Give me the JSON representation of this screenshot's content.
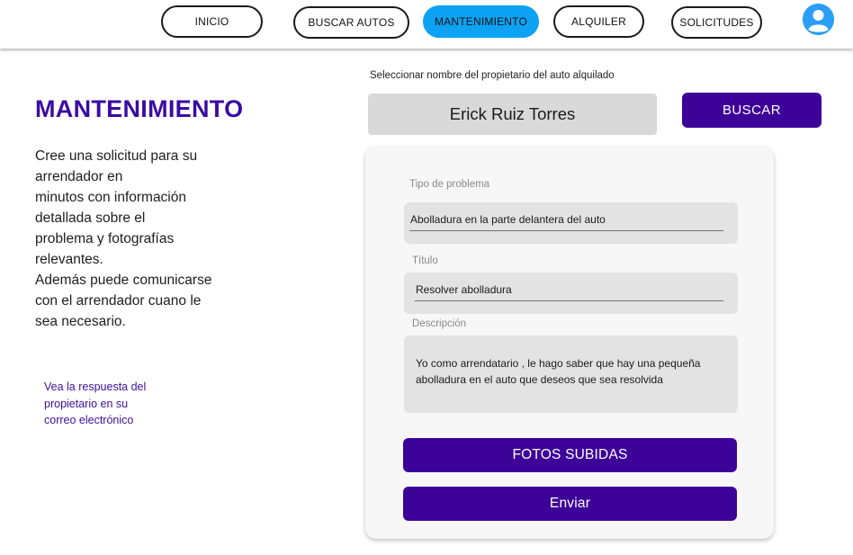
{
  "nav": {
    "items": [
      {
        "label": "INICIO",
        "active": false
      },
      {
        "label": "BUSCAR AUTOS",
        "active": false
      },
      {
        "label": "MANTENIMIENTO",
        "active": true
      },
      {
        "label": "ALQUILER",
        "active": false
      },
      {
        "label": "SOLICITUDES",
        "active": false
      }
    ],
    "avatar_icon": "user-avatar-icon"
  },
  "left": {
    "title": "MANTENIMIENTO",
    "intro": "Cree una solicitud para su\n arrendador en\nminutos con información\ndetallada sobre el\nproblema y fotografías\nrelevantes.\nAdemás puede comunicarse\ncon el arrendador cuano le\nsea necesario.",
    "note": "Vea la respuesta del\npropietario en su\ncorreo electrónico"
  },
  "search": {
    "label": "Seleccionar  nombre del propietario del auto  alquilado",
    "owner_value": "Erick Ruiz Torres",
    "button_label": "BUSCAR"
  },
  "form": {
    "problem_type_label": "Tipo de problema",
    "problem_type_value": "Abolladura en la parte delantera del auto",
    "title_label": "Título",
    "title_value": "Resolver abolladura",
    "description_label": "Descripción",
    "description_value": "Yo como arrendatario , le hago saber que hay una pequeña abolladura en el auto que deseos que sea resolvida",
    "photos_button": "FOTOS SUBIDAS",
    "submit_button": "Enviar"
  },
  "colors": {
    "accent_purple": "#3d0399",
    "title_purple": "#3a0ca3",
    "active_tab_blue": "#0da2f2",
    "avatar_blue": "#2a9df4"
  }
}
